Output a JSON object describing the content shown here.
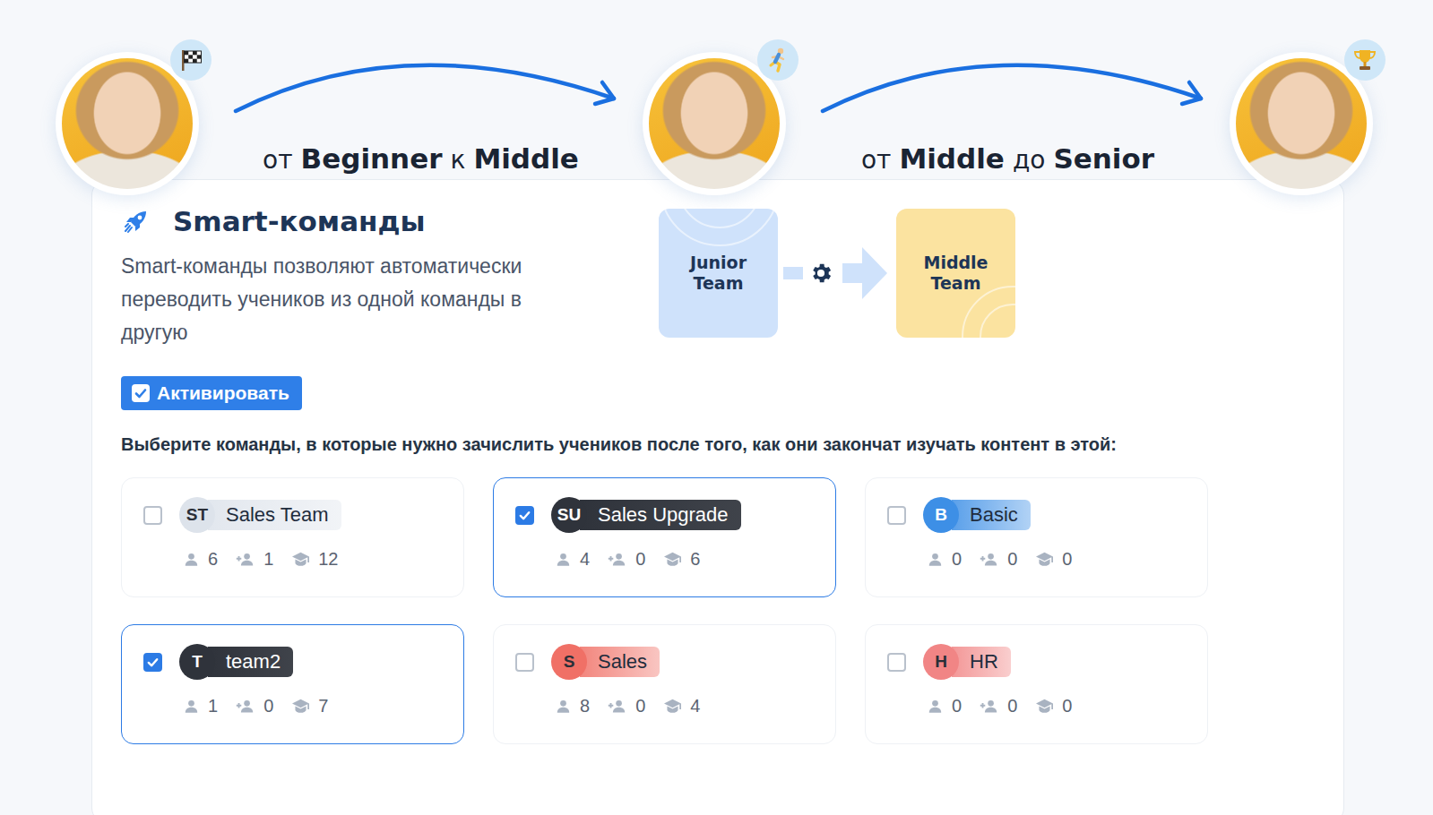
{
  "journey": {
    "stages": [
      {
        "kind": "start"
      },
      {
        "kind": "run"
      },
      {
        "kind": "finish"
      }
    ],
    "transitions": [
      {
        "parts": [
          {
            "text": "от",
            "kind": "plain"
          },
          {
            "text": "Beginner",
            "kind": "bold"
          },
          {
            "text": "к",
            "kind": "plain"
          },
          {
            "text": "Middle",
            "kind": "bold"
          }
        ]
      },
      {
        "parts": [
          {
            "text": "от",
            "kind": "plain"
          },
          {
            "text": "Middle",
            "kind": "bold"
          },
          {
            "text": "до",
            "kind": "plain"
          },
          {
            "text": "Senior",
            "kind": "bold"
          }
        ]
      }
    ]
  },
  "smart_teams": {
    "title": "Smart-команды",
    "description": "Smart-команды позволяют автоматически переводить учеников из одной команды в другую",
    "diagram": {
      "from": "Junior Team",
      "to": "Middle Team"
    },
    "activate": {
      "label": "Активировать",
      "checked": true
    },
    "prompt": "Выберите команды, в которые нужно зачислить учеников после того, как они закончат изучать контент в этой:",
    "teams": [
      {
        "initials": "ST",
        "name": "Sales Team",
        "members": "6",
        "invited": "1",
        "courses": "12",
        "checked": false,
        "color": "#dde3eb"
      },
      {
        "initials": "SU",
        "name": "Sales Upgrade",
        "members": "4",
        "invited": "0",
        "courses": "6",
        "checked": true,
        "color": "#2f333b"
      },
      {
        "initials": "B",
        "name": "Basic",
        "members": "0",
        "invited": "0",
        "courses": "0",
        "checked": false,
        "color": "#3d8fe6"
      },
      {
        "initials": "T",
        "name": "team2",
        "members": "1",
        "invited": "0",
        "courses": "7",
        "checked": true,
        "color": "#2f333b"
      },
      {
        "initials": "S",
        "name": "Sales",
        "members": "8",
        "invited": "0",
        "courses": "4",
        "checked": false,
        "color": "#f07066"
      },
      {
        "initials": "H",
        "name": "HR",
        "members": "0",
        "invited": "0",
        "courses": "0",
        "checked": false,
        "color": "#f18585"
      }
    ]
  }
}
